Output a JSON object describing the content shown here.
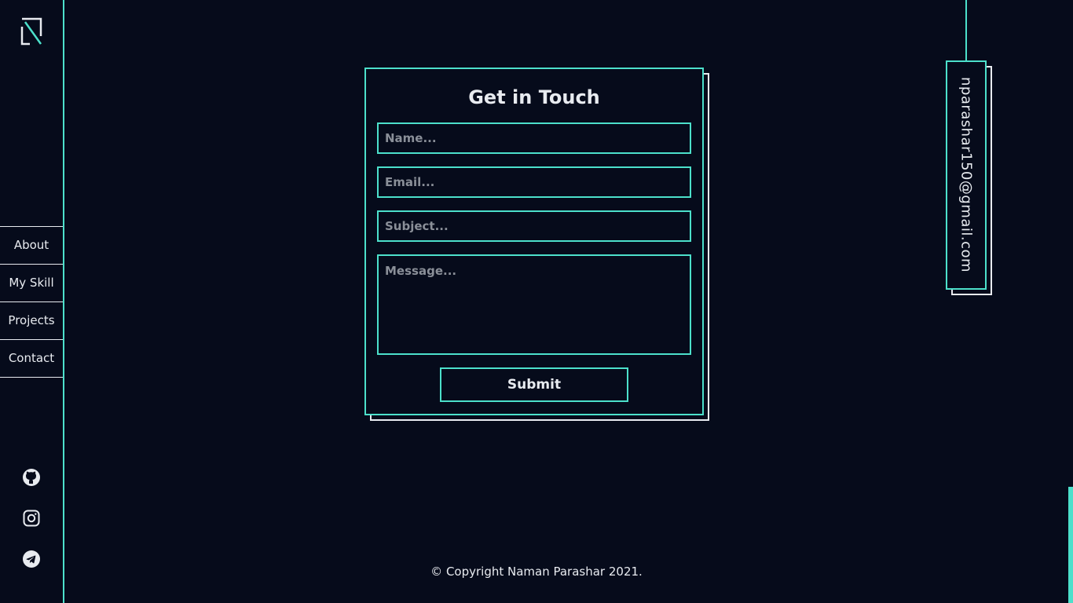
{
  "brand": {
    "logo_icon": "ns-monogram-logo"
  },
  "nav": {
    "items": [
      {
        "label": "About"
      },
      {
        "label": "My Skill"
      },
      {
        "label": "Projects"
      },
      {
        "label": "Contact"
      }
    ]
  },
  "socials": {
    "icons": [
      "github-icon",
      "instagram-icon",
      "telegram-icon"
    ]
  },
  "contact_form": {
    "title": "Get in Touch",
    "name_placeholder": "Name...",
    "email_placeholder": "Email...",
    "subject_placeholder": "Subject...",
    "message_placeholder": "Message...",
    "submit_label": "Submit"
  },
  "email_tag": {
    "email": "nparashar150@gmail.com"
  },
  "footer": {
    "copyright": "© Copyright Naman Parashar 2021."
  },
  "colors": {
    "background": "#060b1b",
    "accent": "#4ce0cb",
    "text": "#e8ebf0"
  }
}
